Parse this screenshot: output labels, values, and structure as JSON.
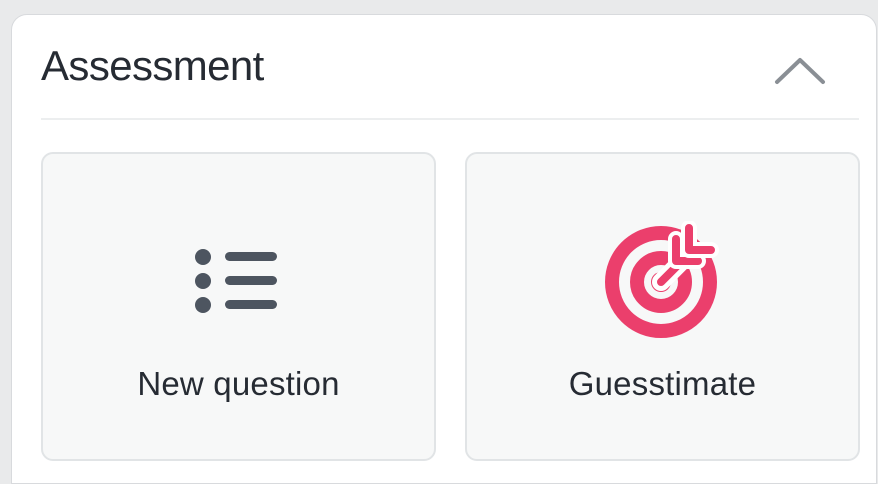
{
  "panel": {
    "title": "Assessment",
    "collapse_icon": "chevron-up-icon",
    "cards": [
      {
        "label": "New question",
        "icon": "list-icon",
        "icon_color": "#4d5560"
      },
      {
        "label": "Guesstimate",
        "icon": "target-icon",
        "icon_color": "#eb3f6c"
      }
    ]
  }
}
